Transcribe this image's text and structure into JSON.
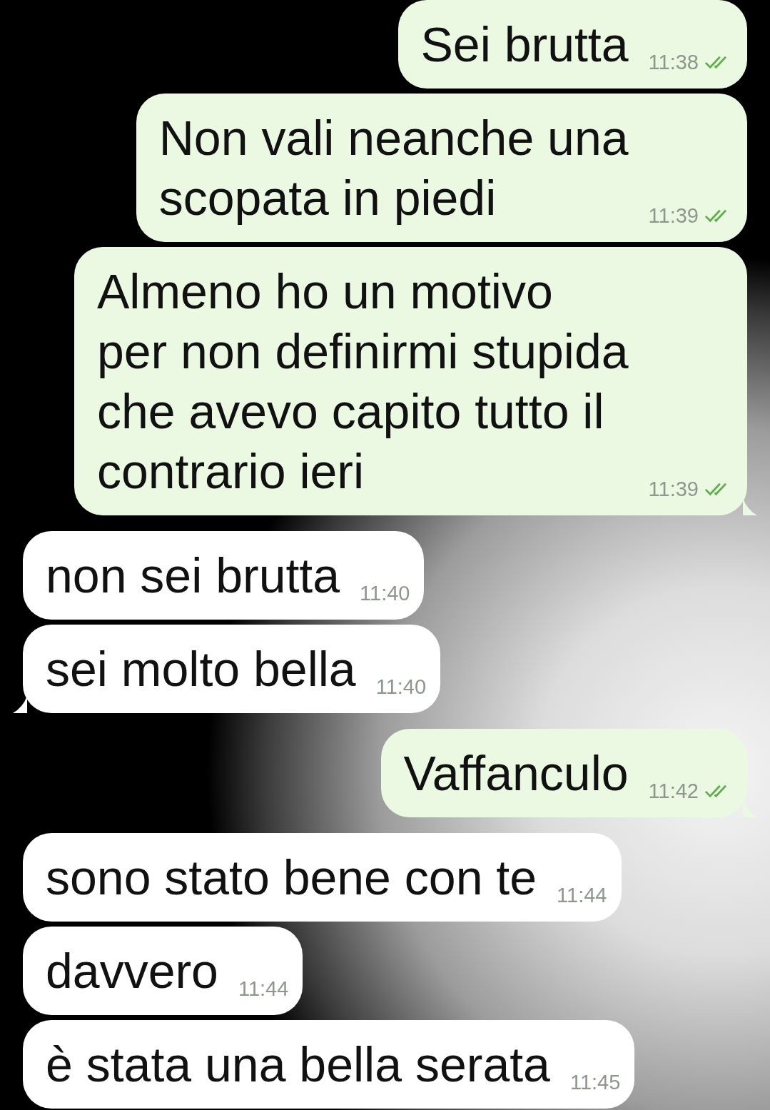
{
  "messages": [
    {
      "kind": "sent",
      "text": "Sei brutta",
      "time": "11:38",
      "read": true,
      "tail": false
    },
    {
      "kind": "sent",
      "text": "Non vali neanche una\nscopata in piedi",
      "time": "11:39",
      "read": true,
      "tail": false
    },
    {
      "kind": "sent",
      "text": "Almeno ho un motivo\nper non definirmi stupida\nche avevo capito tutto il\ncontrario ieri",
      "time": "11:39",
      "read": true,
      "tail": true
    },
    {
      "kind": "received",
      "text": "non sei brutta",
      "time": "11:40",
      "tail": false
    },
    {
      "kind": "received",
      "text": "sei molto bella",
      "time": "11:40",
      "tail": true
    },
    {
      "kind": "sent",
      "text": "Vaffanculo",
      "time": "11:42",
      "read": true,
      "tail": true
    },
    {
      "kind": "received",
      "text": "sono stato bene con te",
      "time": "11:44",
      "tail": false
    },
    {
      "kind": "received",
      "text": "davvero",
      "time": "11:44",
      "tail": false
    },
    {
      "kind": "received",
      "text": "è stata una bella serata",
      "time": "11:45",
      "tail": false
    }
  ]
}
